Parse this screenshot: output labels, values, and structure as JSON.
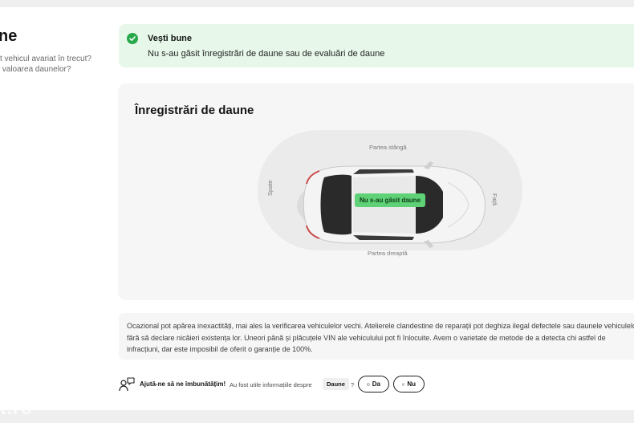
{
  "side": {
    "title": "ne",
    "question": "t vehicul avariat în trecut?\n valoarea daunelor?"
  },
  "good_news": {
    "title": "Vești bune",
    "text": "Nu s-au găsit înregistrări de daune sau de evaluări de daune"
  },
  "damage_records": {
    "title": "Înregistrări de daune",
    "label_left": "Partea stângă",
    "label_right": "Partea dreaptă",
    "label_back": "Spate",
    "label_front": "Față",
    "badge": "Nu s-au găsit daune"
  },
  "disclaimer": {
    "text": "Ocazional pot apărea inexactități, mai ales la verificarea vehiculelor vechi. Atelierele clandestine de reparații pot deghiza ilegal defectele sau daunele vehiculelor, fără să declare nicăieri existența lor. Uneori până și plăcuțele VIN ale vehiculului pot fi înlocuite. Avem o varietate de metode de a detecta chi astfel de infracțiuni, dar este imposibil de oferit o garanție de 100%."
  },
  "feedback": {
    "title": "Ajută-ne să ne îmbunătățim!",
    "question": "Au fost utile informațiile despre",
    "topic": "Daune",
    "question_mark": "?",
    "yes_label": "Da",
    "no_label": "Nu"
  },
  "watermark": "t.ro",
  "colors": {
    "success_bg": "#e7f8ea",
    "success_icon": "#26a94a",
    "badge_bg": "#5fd176",
    "card_bg": "#f6f6f6"
  }
}
